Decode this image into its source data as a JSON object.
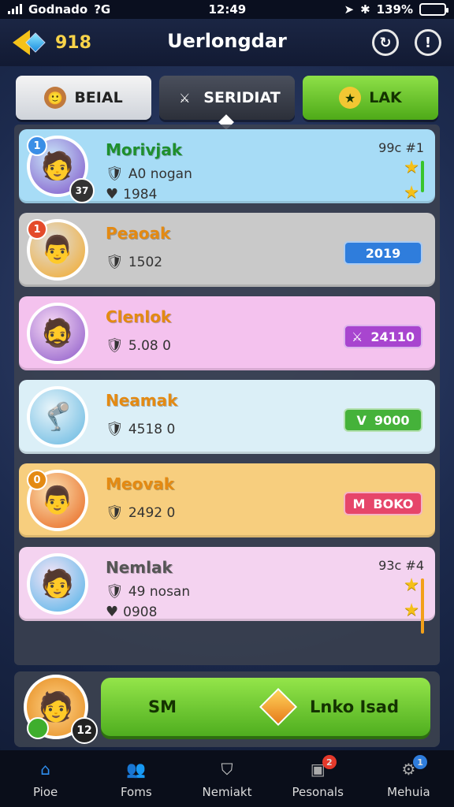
{
  "status": {
    "carrier": "Godnado",
    "network": "?G",
    "time": "12:49",
    "battery_label": "139%"
  },
  "header": {
    "coins": "918",
    "title": "Uerlongdar"
  },
  "tabs": [
    {
      "label": "BEIAL"
    },
    {
      "label": "SERIDIAT"
    },
    {
      "label": "LAK"
    }
  ],
  "rows": [
    {
      "rank": "1",
      "name": "Morivjak",
      "stat1": "A0 nogan",
      "stat2": "1984",
      "right_text": "99c #1",
      "score": "",
      "bg": "#a7dcf6",
      "name_color": "#1e8f2d",
      "avatar_bg": "#7c4fc8",
      "rank_color": "#3a8ee6",
      "avatar_emoji": "🧑",
      "corner": "37"
    },
    {
      "rank": "1",
      "name": "Peaoak",
      "stat1": "1502",
      "stat2": "",
      "right_text": "",
      "score": "2019",
      "bg": "#c9c9c9",
      "name_color": "#e48a12",
      "avatar_bg": "#f3a826",
      "rank_color": "#e44b2a",
      "avatar_emoji": "👨",
      "corner": "",
      "pill_bg": "#2f7ddc"
    },
    {
      "rank": "",
      "name": "Clenlok",
      "stat1": "5.08 0",
      "stat2": "",
      "right_text": "",
      "score": "24110",
      "bg": "#f4c2ee",
      "name_color": "#e48a12",
      "avatar_bg": "#8a57c8",
      "rank_color": "#3fae2d",
      "avatar_emoji": "🧔",
      "corner": "",
      "pill_bg": "#a845cf"
    },
    {
      "rank": "",
      "name": "Neamak",
      "stat1": "4518 0",
      "stat2": "",
      "right_text": "",
      "score": "9000",
      "bg": "#dbeff7",
      "name_color": "#e48a12",
      "avatar_bg": "#63b6e0",
      "rank_color": "#3fae2d",
      "avatar_emoji": "🦿",
      "corner": "",
      "pill_bg": "#45b23a"
    },
    {
      "rank": "0",
      "name": "Meovak",
      "stat1": "2492 0",
      "stat2": "",
      "right_text": "",
      "score": "BOKO",
      "bg": "#f7ce7e",
      "name_color": "#e48a12",
      "avatar_bg": "#e8641c",
      "rank_color": "#e48a12",
      "avatar_emoji": "👨",
      "corner": "",
      "pill_bg": "#e6456a"
    },
    {
      "rank": "",
      "name": "Nemlak",
      "stat1": "49 nosan",
      "stat2": "0908",
      "right_text": "93c #4",
      "score": "",
      "bg": "#f4d3f0",
      "name_color": "#555",
      "avatar_bg": "#4bb1e8",
      "rank_color": "#3fae2d",
      "avatar_emoji": "🧑",
      "corner": "",
      "pill_bg": ""
    }
  ],
  "pill_prefixes": [
    "",
    "",
    "⚔",
    "V",
    "M",
    ""
  ],
  "footer": {
    "level": "12",
    "cta_left": "SM",
    "cta_right": "Lnko Isad"
  },
  "nav": [
    {
      "label": "Pioe",
      "icon": "home-icon",
      "color": "#2f8ff0",
      "badge": ""
    },
    {
      "label": "Foms",
      "icon": "users-icon",
      "color": "#aaa",
      "badge": ""
    },
    {
      "label": "Nemiakt",
      "icon": "shield-icon",
      "color": "#ccc",
      "badge": ""
    },
    {
      "label": "Pesonals",
      "icon": "chest-icon",
      "color": "#aaa",
      "badge": "2"
    },
    {
      "label": "Mehuia",
      "icon": "gear-icon",
      "color": "#aaa",
      "badge": "1"
    }
  ]
}
